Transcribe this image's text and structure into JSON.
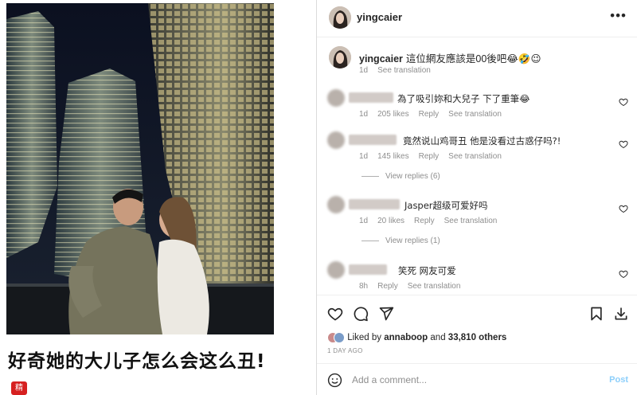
{
  "image_panel": {
    "caption": "好奇她的大儿子怎么会这么丑!",
    "badge": "精"
  },
  "header": {
    "username": "yingcaier",
    "more_icon": "more-horizontal-icon"
  },
  "owner_comment": {
    "username": "yingcaier",
    "text": "這位網友應該是00後吧😂🤣😉",
    "time": "1d",
    "see_translation": "See translation"
  },
  "comments": [
    {
      "text": "為了吸引妳和大兒子 下了重筆😂",
      "time": "1d",
      "likes": "205 likes",
      "reply": "Reply",
      "see_translation": "See translation"
    },
    {
      "text": "竟然说山鸡哥丑 他是没看过古惑仔吗?!",
      "time": "1d",
      "likes": "145 likes",
      "reply": "Reply",
      "see_translation": "See translation",
      "view_replies": "View replies (6)"
    },
    {
      "text": "Jasper超级可爱好吗",
      "time": "1d",
      "likes": "20 likes",
      "reply": "Reply",
      "see_translation": "See translation",
      "view_replies": "View replies (1)"
    },
    {
      "text": "笑死 网友可爱",
      "time": "8h",
      "reply": "Reply",
      "see_translation": "See translation"
    }
  ],
  "likes": {
    "prefix": "Liked by",
    "user": "annaboop",
    "middle": "and",
    "others": "33,810 others"
  },
  "date": "1 DAY AGO",
  "add_comment": {
    "placeholder": "Add a comment...",
    "post_label": "Post"
  },
  "colors": {
    "link_blue": "#0095f6",
    "secondary_text": "#8e8e8e",
    "badge_red": "#d62020"
  }
}
